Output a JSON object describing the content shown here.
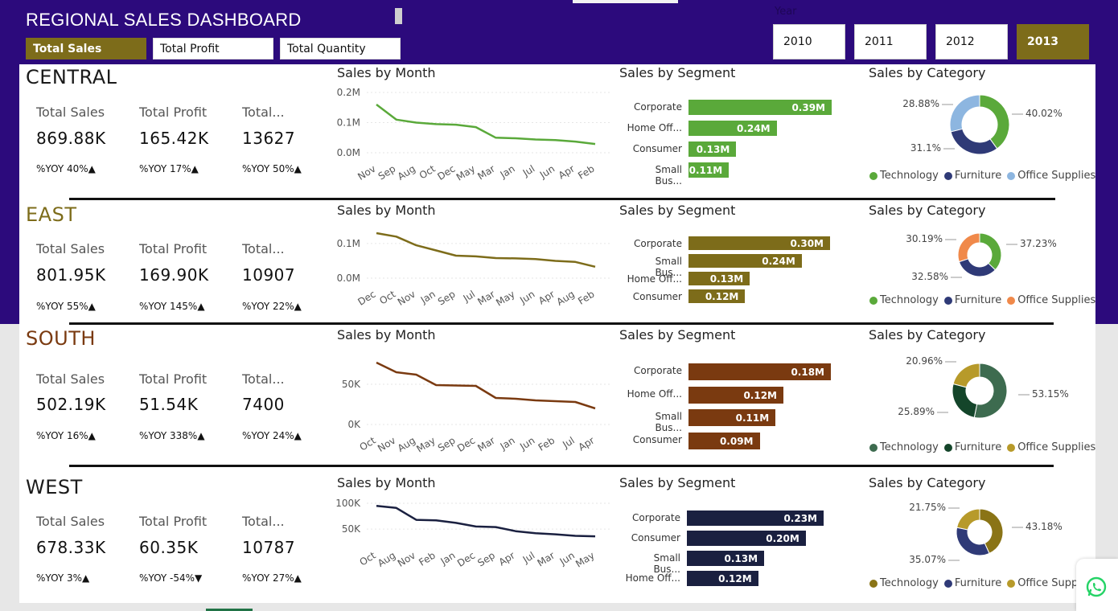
{
  "title": "REGIONAL SALES DASHBOARD",
  "metric_buttons": [
    {
      "label": "Total Sales",
      "active": true
    },
    {
      "label": "Total Profit",
      "active": false
    },
    {
      "label": "Total Quantity",
      "active": false
    }
  ],
  "year_filter": {
    "label": "Year",
    "years": [
      {
        "label": "2010",
        "active": false
      },
      {
        "label": "2011",
        "active": false
      },
      {
        "label": "2012",
        "active": false
      },
      {
        "label": "2013",
        "active": true
      }
    ]
  },
  "regions": [
    {
      "name": "CENTRAL",
      "name_color": "#1a1a1a",
      "kpis": [
        {
          "label": "Total Sales",
          "value": "869.88K",
          "yoy": "%YOY 40%▲"
        },
        {
          "label": "Total Profit",
          "value": "165.42K",
          "yoy": "%YOY 17%▲"
        },
        {
          "label": "Total...",
          "value": "13627",
          "yoy": "%YOY 50%▲"
        }
      ],
      "month_chart": {
        "title": "Sales by Month",
        "color": "#5aa93a",
        "ytick_labels": [
          "0.2M",
          "0.1M",
          "0.0M"
        ],
        "ytick_values": [
          0.2,
          0.1,
          0.0
        ],
        "ylim": [
          0,
          0.2
        ],
        "months": [
          "Nov",
          "Sep",
          "Aug",
          "Oct",
          "Dec",
          "May",
          "Mar",
          "Jan",
          "Jul",
          "Jun",
          "Apr",
          "Feb"
        ],
        "values": [
          0.16,
          0.11,
          0.1,
          0.095,
          0.093,
          0.085,
          0.05,
          0.048,
          0.044,
          0.042,
          0.037,
          0.029
        ]
      },
      "segment_chart": {
        "title": "Sales by Segment",
        "color": "#5aa93a",
        "max": 0.39,
        "items": [
          {
            "name": "Corporate",
            "value": 0.39,
            "label": "0.39M"
          },
          {
            "name": "Home Off...",
            "value": 0.24,
            "label": "0.24M"
          },
          {
            "name": "Consumer",
            "value": 0.13,
            "label": "0.13M"
          },
          {
            "name": "Small Bus...",
            "value": 0.11,
            "label": "0.11M"
          }
        ]
      },
      "category_chart": {
        "title": "Sales by Category",
        "slices": [
          {
            "name": "Technology",
            "value": 40.02,
            "label": "40.02%",
            "color": "#5aa93a"
          },
          {
            "name": "Furniture",
            "value": 31.1,
            "label": "31.1%",
            "color": "#2f3a77"
          },
          {
            "name": "Office Supplies",
            "value": 28.88,
            "label": "28.88%",
            "color": "#8db6e0"
          }
        ]
      }
    },
    {
      "name": "EAST",
      "name_color": "#7d6c1a",
      "kpis": [
        {
          "label": "Total Sales",
          "value": "801.95K",
          "yoy": "%YOY 55%▲"
        },
        {
          "label": "Total Profit",
          "value": "169.90K",
          "yoy": "%YOY 145%▲"
        },
        {
          "label": "Total...",
          "value": "10907",
          "yoy": "%YOY 22%▲"
        }
      ],
      "month_chart": {
        "title": "Sales by Month",
        "color": "#7d6c1a",
        "ytick_labels": [
          "0.1M",
          "0.0M"
        ],
        "ytick_values": [
          0.1,
          0.0
        ],
        "ylim": [
          0,
          0.13
        ],
        "months": [
          "Dec",
          "Oct",
          "Nov",
          "Jan",
          "Sep",
          "Jul",
          "Mar",
          "May",
          "Jun",
          "Apr",
          "Aug",
          "Feb"
        ],
        "values": [
          0.13,
          0.12,
          0.095,
          0.08,
          0.065,
          0.063,
          0.058,
          0.057,
          0.055,
          0.05,
          0.047,
          0.033
        ]
      },
      "segment_chart": {
        "title": "Sales by Segment",
        "color": "#7d6c1a",
        "max": 0.3,
        "items": [
          {
            "name": "Corporate",
            "value": 0.3,
            "label": "0.30M"
          },
          {
            "name": "Small Bus...",
            "value": 0.24,
            "label": "0.24M"
          },
          {
            "name": "Home Off...",
            "value": 0.13,
            "label": "0.13M"
          },
          {
            "name": "Consumer",
            "value": 0.12,
            "label": "0.12M"
          }
        ]
      },
      "category_chart": {
        "title": "Sales by Category",
        "slices": [
          {
            "name": "Technology",
            "value": 37.23,
            "label": "37.23%",
            "color": "#5aa93a"
          },
          {
            "name": "Furniture",
            "value": 32.58,
            "label": "32.58%",
            "color": "#2f3a77"
          },
          {
            "name": "Office Supplies",
            "value": 30.19,
            "label": "30.19%",
            "color": "#f0894a"
          }
        ]
      }
    },
    {
      "name": "SOUTH",
      "name_color": "#7a3a10",
      "kpis": [
        {
          "label": "Total Sales",
          "value": "502.19K",
          "yoy": "%YOY 16%▲"
        },
        {
          "label": "Total Profit",
          "value": "51.54K",
          "yoy": "%YOY 338%▲"
        },
        {
          "label": "Total...",
          "value": "7400",
          "yoy": "%YOY 24%▲"
        }
      ],
      "month_chart": {
        "title": "Sales by Month",
        "color": "#7a3a10",
        "ytick_labels": [
          "50K",
          "0K"
        ],
        "ytick_values": [
          50,
          0
        ],
        "ylim": [
          0,
          80
        ],
        "months": [
          "Oct",
          "Nov",
          "Aug",
          "May",
          "Sep",
          "Dec",
          "Mar",
          "Jan",
          "Jun",
          "Feb",
          "Jul",
          "Apr"
        ],
        "values": [
          77,
          65,
          62,
          49,
          48.5,
          48,
          33,
          32,
          30,
          29,
          28,
          20
        ]
      },
      "segment_chart": {
        "title": "Sales by Segment",
        "color": "#7a3a10",
        "max": 0.18,
        "items": [
          {
            "name": "Corporate",
            "value": 0.18,
            "label": "0.18M"
          },
          {
            "name": "Home Off...",
            "value": 0.12,
            "label": "0.12M"
          },
          {
            "name": "Small Bus...",
            "value": 0.11,
            "label": "0.11M"
          },
          {
            "name": "Consumer",
            "value": 0.09,
            "label": "0.09M"
          }
        ]
      },
      "category_chart": {
        "title": "Sales by Category",
        "slices": [
          {
            "name": "Technology",
            "value": 53.15,
            "label": "53.15%",
            "color": "#3d6b4f"
          },
          {
            "name": "Furniture",
            "value": 25.89,
            "label": "25.89%",
            "color": "#14452a"
          },
          {
            "name": "Office Supplies",
            "value": 20.96,
            "label": "20.96%",
            "color": "#b79a2a"
          }
        ]
      }
    },
    {
      "name": "WEST",
      "name_color": "#1a1a1a",
      "kpis": [
        {
          "label": "Total Sales",
          "value": "678.33K",
          "yoy": "%YOY 3%▲"
        },
        {
          "label": "Total Profit",
          "value": "60.35K",
          "yoy": "%YOY -54%▼"
        },
        {
          "label": "Total...",
          "value": "10787",
          "yoy": "%YOY 27%▲"
        }
      ],
      "month_chart": {
        "title": "Sales by Month",
        "color": "#1a2040",
        "ytick_labels": [
          "100K",
          "50K"
        ],
        "ytick_values": [
          100,
          50
        ],
        "ylim": [
          30,
          100
        ],
        "months": [
          "Oct",
          "Aug",
          "Nov",
          "Feb",
          "Jan",
          "Dec",
          "Sep",
          "Apr",
          "Jul",
          "Mar",
          "Jun",
          "May"
        ],
        "values": [
          95,
          91,
          68,
          67,
          62,
          55,
          54,
          46,
          42,
          40,
          37,
          36
        ]
      },
      "segment_chart": {
        "title": "Sales by Segment",
        "color": "#1a2040",
        "max": 0.23,
        "items": [
          {
            "name": "Corporate",
            "value": 0.23,
            "label": "0.23M"
          },
          {
            "name": "Consumer",
            "value": 0.2,
            "label": "0.20M"
          },
          {
            "name": "Small Bus...",
            "value": 0.13,
            "label": "0.13M"
          },
          {
            "name": "Home Off...",
            "value": 0.12,
            "label": "0.12M"
          }
        ]
      },
      "category_chart": {
        "title": "Sales by Category",
        "slices": [
          {
            "name": "Technology",
            "value": 43.18,
            "label": "43.18%",
            "color": "#8a7416"
          },
          {
            "name": "Furniture",
            "value": 35.07,
            "label": "35.07%",
            "color": "#2f3a77"
          },
          {
            "name": "Office Supplies",
            "value": 21.75,
            "label": "21.75%",
            "color": "#b79a2a"
          }
        ]
      }
    }
  ],
  "chart_data": [
    {
      "type": "line",
      "title": "Sales by Month",
      "region": "CENTRAL",
      "x": [
        "Nov",
        "Sep",
        "Aug",
        "Oct",
        "Dec",
        "May",
        "Mar",
        "Jan",
        "Jul",
        "Jun",
        "Apr",
        "Feb"
      ],
      "values": [
        0.16,
        0.11,
        0.1,
        0.095,
        0.093,
        0.085,
        0.05,
        0.048,
        0.044,
        0.042,
        0.037,
        0.029
      ],
      "ylim": [
        0,
        0.2
      ]
    },
    {
      "type": "bar",
      "title": "Sales by Segment",
      "region": "CENTRAL",
      "categories": [
        "Corporate",
        "Home Off...",
        "Consumer",
        "Small Bus..."
      ],
      "values": [
        0.39,
        0.24,
        0.13,
        0.11
      ]
    },
    {
      "type": "pie",
      "title": "Sales by Category",
      "region": "CENTRAL",
      "categories": [
        "Technology",
        "Furniture",
        "Office Supplies"
      ],
      "values": [
        40.02,
        31.1,
        28.88
      ]
    },
    {
      "type": "line",
      "title": "Sales by Month",
      "region": "EAST",
      "x": [
        "Dec",
        "Oct",
        "Nov",
        "Jan",
        "Sep",
        "Jul",
        "Mar",
        "May",
        "Jun",
        "Apr",
        "Aug",
        "Feb"
      ],
      "values": [
        0.13,
        0.12,
        0.095,
        0.08,
        0.065,
        0.063,
        0.058,
        0.057,
        0.055,
        0.05,
        0.047,
        0.033
      ],
      "ylim": [
        0,
        0.13
      ]
    },
    {
      "type": "bar",
      "title": "Sales by Segment",
      "region": "EAST",
      "categories": [
        "Corporate",
        "Small Bus...",
        "Home Off...",
        "Consumer"
      ],
      "values": [
        0.3,
        0.24,
        0.13,
        0.12
      ]
    },
    {
      "type": "pie",
      "title": "Sales by Category",
      "region": "EAST",
      "categories": [
        "Technology",
        "Furniture",
        "Office Supplies"
      ],
      "values": [
        37.23,
        32.58,
        30.19
      ]
    },
    {
      "type": "line",
      "title": "Sales by Month",
      "region": "SOUTH",
      "x": [
        "Oct",
        "Nov",
        "Aug",
        "May",
        "Sep",
        "Dec",
        "Mar",
        "Jan",
        "Jun",
        "Feb",
        "Jul",
        "Apr"
      ],
      "values": [
        77,
        65,
        62,
        49,
        48.5,
        48,
        33,
        32,
        30,
        29,
        28,
        20
      ],
      "ylim": [
        0,
        80
      ]
    },
    {
      "type": "bar",
      "title": "Sales by Segment",
      "region": "SOUTH",
      "categories": [
        "Corporate",
        "Home Off...",
        "Small Bus...",
        "Consumer"
      ],
      "values": [
        0.18,
        0.12,
        0.11,
        0.09
      ]
    },
    {
      "type": "pie",
      "title": "Sales by Category",
      "region": "SOUTH",
      "categories": [
        "Technology",
        "Furniture",
        "Office Supplies"
      ],
      "values": [
        53.15,
        25.89,
        20.96
      ]
    },
    {
      "type": "line",
      "title": "Sales by Month",
      "region": "WEST",
      "x": [
        "Oct",
        "Aug",
        "Nov",
        "Feb",
        "Jan",
        "Dec",
        "Sep",
        "Apr",
        "Jul",
        "Mar",
        "Jun",
        "May"
      ],
      "values": [
        95,
        91,
        68,
        67,
        62,
        55,
        54,
        46,
        42,
        40,
        37,
        36
      ],
      "ylim": [
        30,
        100
      ]
    },
    {
      "type": "bar",
      "title": "Sales by Segment",
      "region": "WEST",
      "categories": [
        "Corporate",
        "Consumer",
        "Small Bus...",
        "Home Off..."
      ],
      "values": [
        0.23,
        0.2,
        0.13,
        0.12
      ]
    },
    {
      "type": "pie",
      "title": "Sales by Category",
      "region": "WEST",
      "categories": [
        "Technology",
        "Furniture",
        "Office Supplies"
      ],
      "values": [
        43.18,
        35.07,
        21.75
      ]
    }
  ],
  "chat_button": {
    "icon": "whatsapp-icon"
  }
}
